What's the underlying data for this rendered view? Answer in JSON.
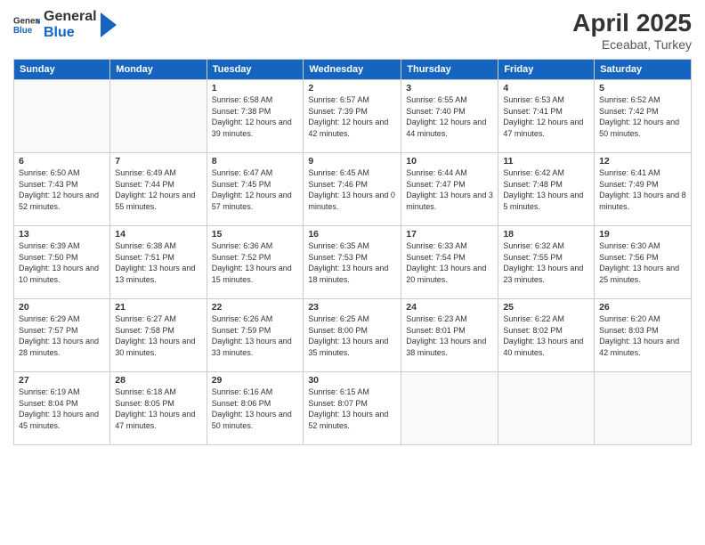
{
  "header": {
    "logo_general": "General",
    "logo_blue": "Blue",
    "month": "April 2025",
    "location": "Eceabat, Turkey"
  },
  "days_of_week": [
    "Sunday",
    "Monday",
    "Tuesday",
    "Wednesday",
    "Thursday",
    "Friday",
    "Saturday"
  ],
  "weeks": [
    [
      {
        "day": "",
        "info": ""
      },
      {
        "day": "",
        "info": ""
      },
      {
        "day": "1",
        "info": "Sunrise: 6:58 AM\nSunset: 7:38 PM\nDaylight: 12 hours and 39 minutes."
      },
      {
        "day": "2",
        "info": "Sunrise: 6:57 AM\nSunset: 7:39 PM\nDaylight: 12 hours and 42 minutes."
      },
      {
        "day": "3",
        "info": "Sunrise: 6:55 AM\nSunset: 7:40 PM\nDaylight: 12 hours and 44 minutes."
      },
      {
        "day": "4",
        "info": "Sunrise: 6:53 AM\nSunset: 7:41 PM\nDaylight: 12 hours and 47 minutes."
      },
      {
        "day": "5",
        "info": "Sunrise: 6:52 AM\nSunset: 7:42 PM\nDaylight: 12 hours and 50 minutes."
      }
    ],
    [
      {
        "day": "6",
        "info": "Sunrise: 6:50 AM\nSunset: 7:43 PM\nDaylight: 12 hours and 52 minutes."
      },
      {
        "day": "7",
        "info": "Sunrise: 6:49 AM\nSunset: 7:44 PM\nDaylight: 12 hours and 55 minutes."
      },
      {
        "day": "8",
        "info": "Sunrise: 6:47 AM\nSunset: 7:45 PM\nDaylight: 12 hours and 57 minutes."
      },
      {
        "day": "9",
        "info": "Sunrise: 6:45 AM\nSunset: 7:46 PM\nDaylight: 13 hours and 0 minutes."
      },
      {
        "day": "10",
        "info": "Sunrise: 6:44 AM\nSunset: 7:47 PM\nDaylight: 13 hours and 3 minutes."
      },
      {
        "day": "11",
        "info": "Sunrise: 6:42 AM\nSunset: 7:48 PM\nDaylight: 13 hours and 5 minutes."
      },
      {
        "day": "12",
        "info": "Sunrise: 6:41 AM\nSunset: 7:49 PM\nDaylight: 13 hours and 8 minutes."
      }
    ],
    [
      {
        "day": "13",
        "info": "Sunrise: 6:39 AM\nSunset: 7:50 PM\nDaylight: 13 hours and 10 minutes."
      },
      {
        "day": "14",
        "info": "Sunrise: 6:38 AM\nSunset: 7:51 PM\nDaylight: 13 hours and 13 minutes."
      },
      {
        "day": "15",
        "info": "Sunrise: 6:36 AM\nSunset: 7:52 PM\nDaylight: 13 hours and 15 minutes."
      },
      {
        "day": "16",
        "info": "Sunrise: 6:35 AM\nSunset: 7:53 PM\nDaylight: 13 hours and 18 minutes."
      },
      {
        "day": "17",
        "info": "Sunrise: 6:33 AM\nSunset: 7:54 PM\nDaylight: 13 hours and 20 minutes."
      },
      {
        "day": "18",
        "info": "Sunrise: 6:32 AM\nSunset: 7:55 PM\nDaylight: 13 hours and 23 minutes."
      },
      {
        "day": "19",
        "info": "Sunrise: 6:30 AM\nSunset: 7:56 PM\nDaylight: 13 hours and 25 minutes."
      }
    ],
    [
      {
        "day": "20",
        "info": "Sunrise: 6:29 AM\nSunset: 7:57 PM\nDaylight: 13 hours and 28 minutes."
      },
      {
        "day": "21",
        "info": "Sunrise: 6:27 AM\nSunset: 7:58 PM\nDaylight: 13 hours and 30 minutes."
      },
      {
        "day": "22",
        "info": "Sunrise: 6:26 AM\nSunset: 7:59 PM\nDaylight: 13 hours and 33 minutes."
      },
      {
        "day": "23",
        "info": "Sunrise: 6:25 AM\nSunset: 8:00 PM\nDaylight: 13 hours and 35 minutes."
      },
      {
        "day": "24",
        "info": "Sunrise: 6:23 AM\nSunset: 8:01 PM\nDaylight: 13 hours and 38 minutes."
      },
      {
        "day": "25",
        "info": "Sunrise: 6:22 AM\nSunset: 8:02 PM\nDaylight: 13 hours and 40 minutes."
      },
      {
        "day": "26",
        "info": "Sunrise: 6:20 AM\nSunset: 8:03 PM\nDaylight: 13 hours and 42 minutes."
      }
    ],
    [
      {
        "day": "27",
        "info": "Sunrise: 6:19 AM\nSunset: 8:04 PM\nDaylight: 13 hours and 45 minutes."
      },
      {
        "day": "28",
        "info": "Sunrise: 6:18 AM\nSunset: 8:05 PM\nDaylight: 13 hours and 47 minutes."
      },
      {
        "day": "29",
        "info": "Sunrise: 6:16 AM\nSunset: 8:06 PM\nDaylight: 13 hours and 50 minutes."
      },
      {
        "day": "30",
        "info": "Sunrise: 6:15 AM\nSunset: 8:07 PM\nDaylight: 13 hours and 52 minutes."
      },
      {
        "day": "",
        "info": ""
      },
      {
        "day": "",
        "info": ""
      },
      {
        "day": "",
        "info": ""
      }
    ]
  ]
}
